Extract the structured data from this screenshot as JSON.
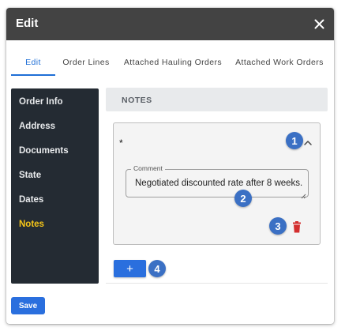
{
  "dialog": {
    "title": "Edit",
    "close_icon": "close-icon"
  },
  "tabs": [
    {
      "label": "Edit",
      "active": true
    },
    {
      "label": "Order Lines",
      "active": false
    },
    {
      "label": "Attached Hauling Orders",
      "active": false
    },
    {
      "label": "Attached Work Orders",
      "active": false
    }
  ],
  "sidebar": {
    "items": [
      {
        "label": "Order Info",
        "active": false
      },
      {
        "label": "Address",
        "active": false
      },
      {
        "label": "Documents",
        "active": false
      },
      {
        "label": "State",
        "active": false
      },
      {
        "label": "Dates",
        "active": false
      },
      {
        "label": "Notes",
        "active": true
      }
    ]
  },
  "notes": {
    "header": "NOTES",
    "note": {
      "title": "*",
      "comment_label": "Comment",
      "comment_value": "Negotiated discounted rate after 8 weeks.",
      "collapse_icon": "chevron-up-icon",
      "delete_icon": "trash-icon"
    },
    "add_label": "+"
  },
  "badges": [
    "1",
    "2",
    "3",
    "4"
  ],
  "footer": {
    "save_label": "Save"
  },
  "colors": {
    "titlebar": "#434343",
    "sidebar": "#242b33",
    "active_sidebar_text": "#f5c518",
    "primary": "#2a6fde",
    "tab_active": "#1f6fd6",
    "badge": "#3b70c4",
    "delete": "#d32f2f"
  }
}
